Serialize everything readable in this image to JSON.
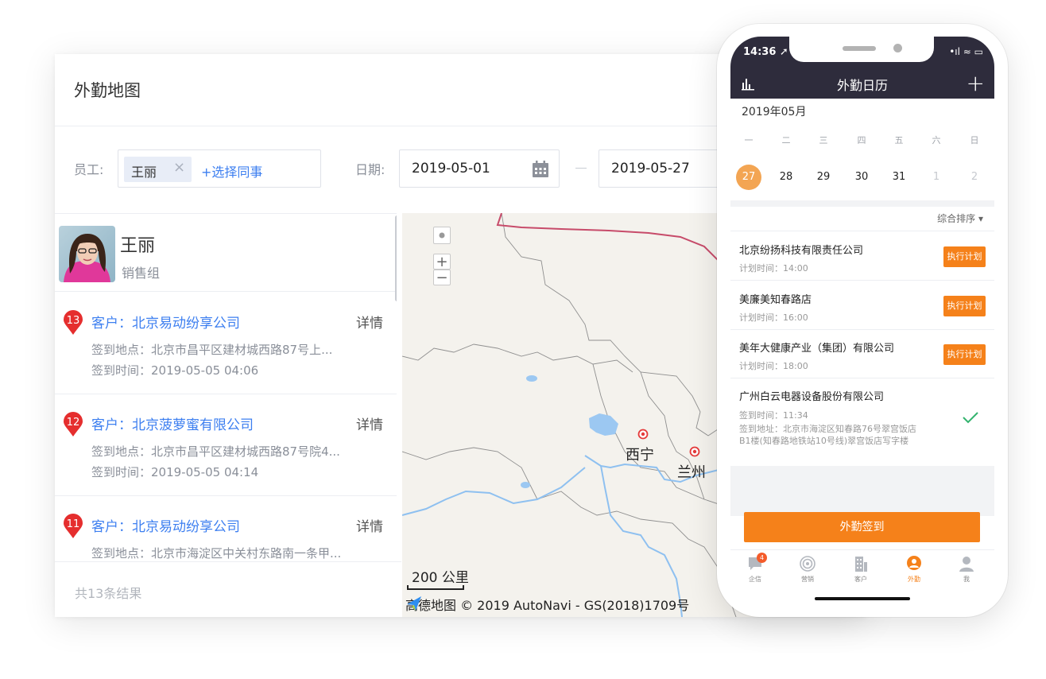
{
  "card": {
    "title": "外勤地图",
    "filter": {
      "employee_label": "员工:",
      "employee_tag": "王丽",
      "employee_remove": "×",
      "add_colleague": "+选择同事",
      "date_label": "日期:",
      "date_start": "2019-05-01",
      "date_end": "2019-05-27"
    },
    "profile": {
      "name": "王丽",
      "group": "销售组"
    },
    "items": [
      {
        "num": "13",
        "customer": "客户：北京易动纷享公司",
        "detail": "详情",
        "address": "签到地点：北京市昌平区建材城西路87号上...",
        "time": "签到时间：2019-05-05 04:06"
      },
      {
        "num": "12",
        "customer": "客户：北京菠萝蜜有限公司",
        "detail": "详情",
        "address": "签到地点：北京市昌平区建材城西路87号院4...",
        "time": "签到时间：2019-05-05 04:14"
      },
      {
        "num": "11",
        "customer": "客户：北京易动纷享公司",
        "detail": "详情",
        "address": "签到地点：北京市海淀区中关村东路南一条甲...",
        "time": ""
      }
    ],
    "footer": "共13条结果"
  },
  "map": {
    "zoom_in": "+",
    "zoom_out": "−",
    "cities": [
      "西宁",
      "兰州"
    ],
    "scale": "200 公里",
    "credit": "高德地图 © 2019 AutoNavi - GS(2018)1709号",
    "colors": {
      "border_red": "#c74b6a",
      "river": "#8ec0f0",
      "land": "#f4f2ed"
    }
  },
  "phone": {
    "time": "14:36 ➚",
    "status_icons": "•ıl ≈ ▭",
    "title": "外勤日历",
    "add": "+",
    "month": "2019年05月",
    "weekdays": [
      "一",
      "二",
      "三",
      "四",
      "五",
      "六",
      "日"
    ],
    "days": [
      "27",
      "28",
      "29",
      "30",
      "31",
      "1",
      "2"
    ],
    "sort": "综合排序 ▾",
    "tasks": [
      {
        "name": "北京纷扬科技有限责任公司",
        "time": "计划时间：14:00",
        "action": "执行计划"
      },
      {
        "name": "美廉美知春路店",
        "time": "计划时间：16:00",
        "action": "执行计划"
      },
      {
        "name": "美年大健康产业（集团）有限公司",
        "time": "计划时间：18:00",
        "action": "执行计划"
      },
      {
        "name": "广州白云电器设备股份有限公司",
        "time": "签到时间：11:34",
        "address1": "签到地址：北京市海淀区知春路76号翠宫饭店",
        "address2": "B1楼(知春路地铁站10号线)翠宫饭店写字楼"
      }
    ],
    "checkin": "外勤签到",
    "tabs": [
      {
        "label": "企信",
        "badge": "4"
      },
      {
        "label": "营销"
      },
      {
        "label": "客户"
      },
      {
        "label": "外勤"
      },
      {
        "label": "我"
      }
    ],
    "accent": "#f5811a"
  }
}
